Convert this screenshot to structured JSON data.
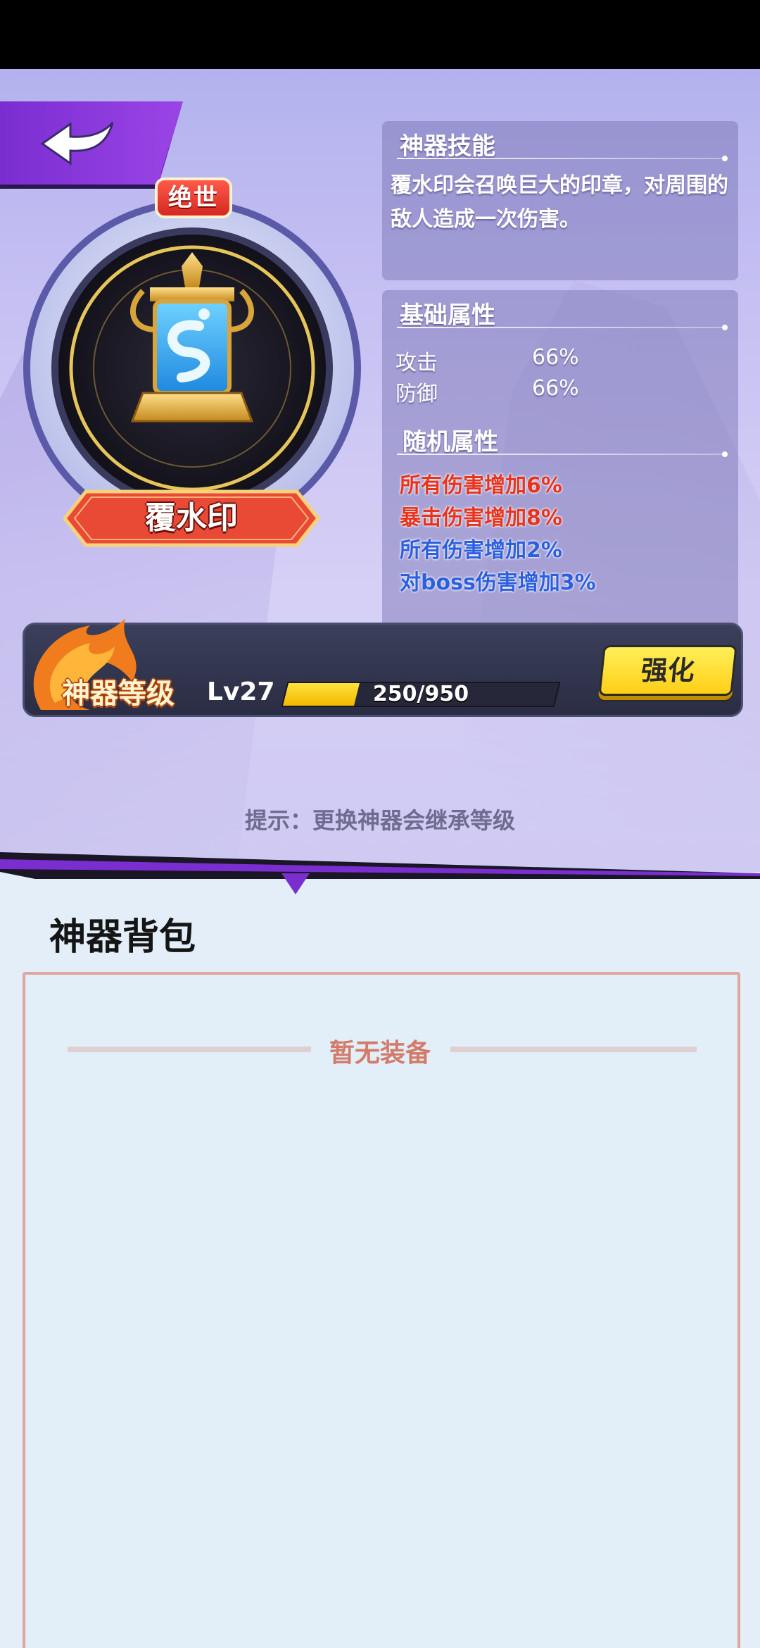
{
  "header": {
    "back_icon": "back-arrow-icon"
  },
  "artifact": {
    "rarity": "绝世",
    "name": "覆水印",
    "icon": "water-seal-icon"
  },
  "skill": {
    "title": "神器技能",
    "description": "覆水印会召唤巨大的印章，对周围的敌人造成一次伤害。"
  },
  "base_attributes": {
    "title": "基础属性",
    "stats": [
      {
        "label": "攻击",
        "value": "66%"
      },
      {
        "label": "防御",
        "value": "66%"
      }
    ]
  },
  "random_attributes": {
    "title": "随机属性",
    "lines": [
      {
        "text": "所有伤害增加6%",
        "color": "#e8331e"
      },
      {
        "text": "暴击伤害增加8%",
        "color": "#e8331e"
      },
      {
        "text": "所有伤害增加2%",
        "color": "#2c5fe0"
      },
      {
        "text": "对boss伤害增加3%",
        "color": "#2c5fe0"
      }
    ]
  },
  "level": {
    "title": "神器等级",
    "lv": "Lv27",
    "xp_current": 250,
    "xp_max": 950,
    "xp_text": "250/950",
    "upgrade_label": "强化"
  },
  "hint": "提示：更换神器会继承等级",
  "bag": {
    "title": "神器背包",
    "empty_text": "暂无装备"
  },
  "colors": {
    "accent_purple": "#7a2ed0",
    "xp_yellow": "#ffcf17",
    "empty_text": "#d27b6a"
  }
}
